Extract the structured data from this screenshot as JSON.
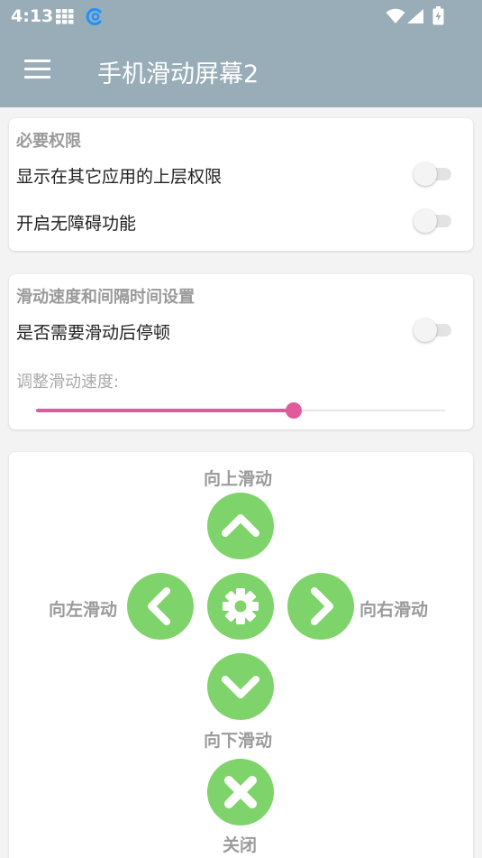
{
  "status_bar": {
    "time": "4:13",
    "icons": [
      "grid-icon",
      "sync-ring-icon",
      "wifi-icon",
      "signal-icon",
      "battery-charging-icon"
    ]
  },
  "app_bar": {
    "title": "手机滑动屏幕2",
    "menu_icon": "menu-icon"
  },
  "permissions": {
    "title": "必要权限",
    "overlay_label": "显示在其它应用的上层权限",
    "overlay_on": false,
    "accessibility_label": "开启无障碍功能",
    "accessibility_on": false
  },
  "speed": {
    "title": "滑动速度和间隔时间设置",
    "pause_label": "是否需要滑动后停顿",
    "pause_on": false,
    "speed_label": "调整滑动速度:",
    "speed_value_fraction": 0.63
  },
  "controls": {
    "up_label": "向上滑动",
    "left_label": "向左滑动",
    "right_label": "向右滑动",
    "down_label": "向下滑动",
    "close_label": "关闭",
    "button_color": "#7ed46a",
    "icons": [
      "chevron-up-icon",
      "chevron-left-icon",
      "gear-icon",
      "chevron-right-icon",
      "chevron-down-icon",
      "close-icon"
    ]
  },
  "colors": {
    "app_bar": "#98adb7",
    "accent": "#e05b9b",
    "control_green": "#7ed46a"
  }
}
